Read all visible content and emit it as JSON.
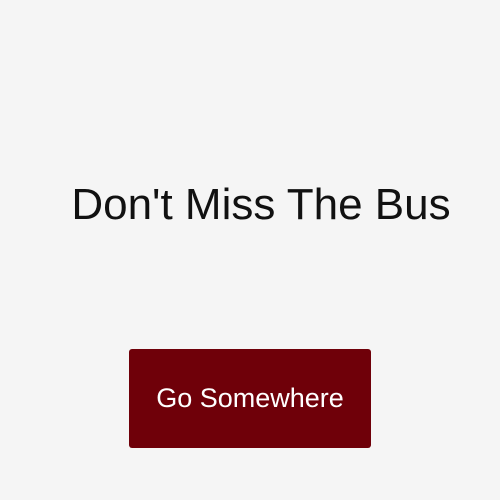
{
  "hero": {
    "headline": "Don't Miss The Bus",
    "cta_label": "Go Somewhere"
  },
  "colors": {
    "background": "#f5f5f5",
    "headline_text": "#111111",
    "cta_background": "#6f0009",
    "cta_text": "#ffffff"
  }
}
